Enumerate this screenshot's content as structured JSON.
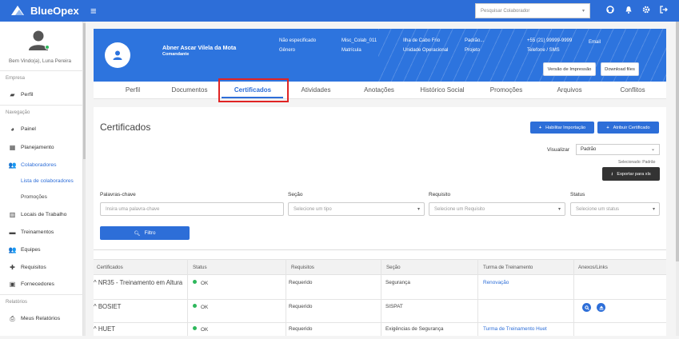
{
  "app": {
    "name": "BlueOpex"
  },
  "topbar": {
    "search_placeholder": "Pesquisar Colaborador"
  },
  "sidebar": {
    "welcome": "Bem Vindo(a), Luna Pereira",
    "sections": {
      "empresa": "Empresa",
      "navegacao": "Navegação",
      "relatorios": "Relatórios"
    },
    "items": {
      "perfil": "Perfil",
      "painel": "Painel",
      "planejamento": "Planejamento",
      "colaboradores": "Colaboradores",
      "lista": "Lista de colaboradores",
      "promocoes": "Promoções",
      "locais": "Locais de Trabalho",
      "treinamentos": "Treinamentos",
      "equipes": "Equipes",
      "requisitos": "Requisitos",
      "fornecedores": "Fornecedores",
      "meus_relatorios": "Meus Relatórios"
    }
  },
  "profile": {
    "name": "Abner Ascar Vilela da Mota",
    "role": "Comandante",
    "fields": [
      {
        "value": "Não especificado",
        "label": "Gênero"
      },
      {
        "value": "Misc_Colab_011",
        "label": "Matrícula"
      },
      {
        "value": "Ilha de Cabo Frio",
        "label": "Unidade Operacional"
      },
      {
        "value": "Padrão...",
        "label": "Projeto"
      },
      {
        "value": "+55 (21) 99999-9999",
        "label": "Telefone / SMS"
      },
      {
        "value": "Email",
        "label": ""
      }
    ],
    "btn_print": "Versão de Impressão",
    "btn_download": "Download files"
  },
  "tabs": [
    "Perfil",
    "Documentos",
    "Certificados",
    "Atividades",
    "Anotações",
    "Histórico Social",
    "Promoções",
    "Arquivos",
    "Conflitos"
  ],
  "active_tab": "Certificados",
  "certificados": {
    "title": "Certificados",
    "btn_import": "Habilitar Importação",
    "btn_assign": "Atribuir Certificado",
    "visualizar_label": "Visualizar",
    "visualizar_value": "Padrão",
    "selected_info": "Selecionado: Padrão",
    "btn_export": "Exportar para xls",
    "filters": {
      "keywords_label": "Palavras-chave",
      "keywords_placeholder": "Insira uma palavra-chave",
      "secao_label": "Seção",
      "secao_placeholder": "Selecione um tipo",
      "requisito_label": "Requisito",
      "requisito_placeholder": "Selecione um Requisito",
      "status_label": "Status",
      "status_placeholder": "Selecione um status",
      "btn_filter": "Filtro"
    },
    "columns": [
      "Certificados",
      "Status",
      "Requisitos",
      "Seção",
      "Turma de Treinamento",
      "Anexos/Links"
    ],
    "rows": [
      {
        "name": "NR35 - Treinamento em Altura",
        "status": "OK",
        "requisito": "Requerido",
        "secao": "Segurança",
        "turma": "Renovação"
      },
      {
        "name": "BOSIET",
        "status": "OK",
        "requisito": "Requerido",
        "secao": "SISPAT",
        "turma": ""
      },
      {
        "name": "HUET",
        "status": "OK",
        "requisito": "Requerido",
        "secao": "Exigências de Segurança",
        "turma": "Turma de Treinamento Huet"
      }
    ]
  }
}
